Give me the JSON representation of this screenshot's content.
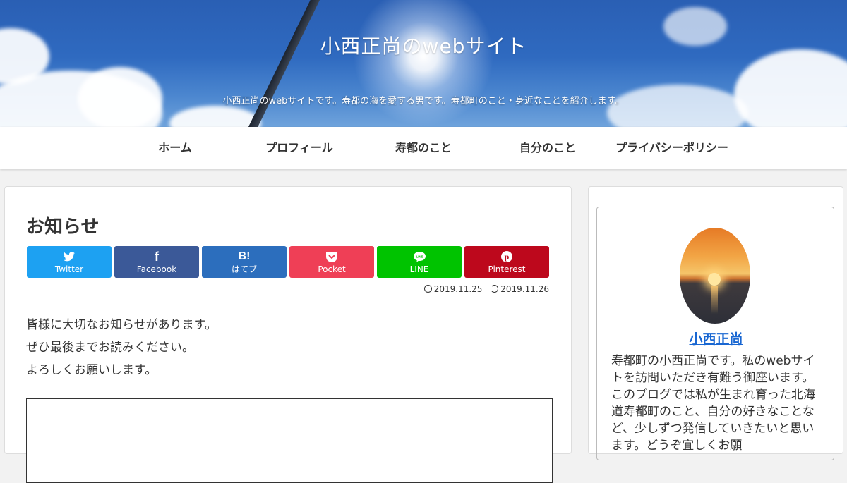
{
  "header": {
    "title": "小西正尚のwebサイト",
    "description": "小西正尚のwebサイトです。寿都の海を愛する男です。寿都町のこと・身近なことを紹介します。"
  },
  "nav": {
    "items": [
      {
        "label": "ホーム"
      },
      {
        "label": "プロフィール"
      },
      {
        "label": "寿都のこと"
      },
      {
        "label": "自分のこと"
      },
      {
        "label": "プライバシーポリシー"
      }
    ]
  },
  "article": {
    "title": "お知らせ",
    "share": [
      {
        "label": "Twitter",
        "icon": "twitter-icon",
        "glyph": "🐦",
        "color": "#1da1f2"
      },
      {
        "label": "Facebook",
        "icon": "facebook-icon",
        "glyph": "f",
        "color": "#3b5998"
      },
      {
        "label": "はてブ",
        "icon": "hatena-bookmark-icon",
        "glyph": "B!",
        "color": "#2c6ebd"
      },
      {
        "label": "Pocket",
        "icon": "pocket-icon",
        "glyph": "◡",
        "color": "#ef3f56"
      },
      {
        "label": "LINE",
        "icon": "line-icon",
        "glyph": "●",
        "color": "#00c300"
      },
      {
        "label": "Pinterest",
        "icon": "pinterest-icon",
        "glyph": "P",
        "color": "#bd081c"
      }
    ],
    "date_published": "2019.11.25",
    "date_updated": "2019.11.26",
    "body": [
      "皆様に大切なお知らせがあります。",
      "ぜひ最後までお読みください。",
      "よろしくお願いします。"
    ]
  },
  "sidebar": {
    "author_name": "小西正尚",
    "author_bio": "寿都町の小西正尚です。私のwebサイトを訪問いただき有難う御座います。このブログでは私が生まれ育った北海道寿都町のこと、自分の好きなことなど、少しずつ発信していきたいと思います。どうぞ宜しくお願"
  }
}
